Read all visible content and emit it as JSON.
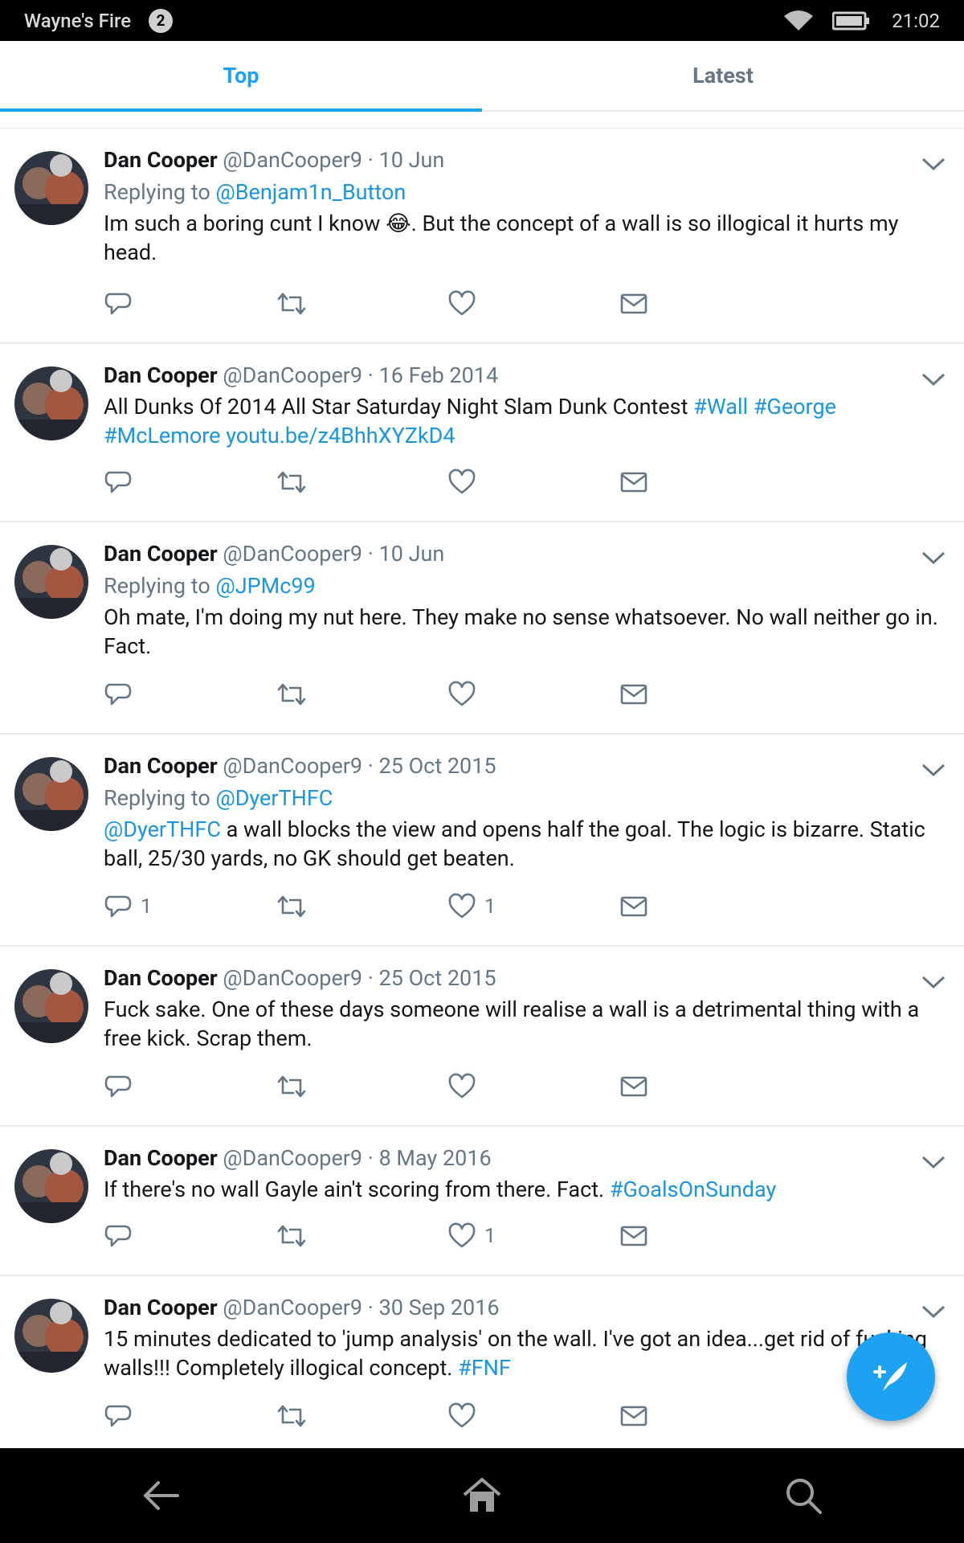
{
  "status_bar": {
    "app_name": "Wayne's Fire",
    "notification_count": "2",
    "time": "21:02",
    "icons": [
      "wifi-icon",
      "battery-icon"
    ]
  },
  "tabs": [
    {
      "label": "Top",
      "active": true
    },
    {
      "label": "Latest",
      "active": false
    }
  ],
  "tweets": [
    {
      "name": "Dan Cooper",
      "handle": "@DanCooper9",
      "date": "10 Jun",
      "replying_prefix": "Replying to",
      "replying_to": "@Benjam1n_Button",
      "text_a": "Im such a boring cunt I know ",
      "emoji": "😂",
      "text_b": ". But the concept of a wall is so illogical it hurts my head.",
      "replies": "",
      "likes": ""
    },
    {
      "name": "Dan Cooper",
      "handle": "@DanCooper9",
      "date": "16 Feb 2014",
      "text_a": "All Dunks Of 2014  All Star Saturday Night Slam Dunk Contest ",
      "tag1": "#Wall",
      "tag2": "#George",
      "tag3": "#McLemore",
      "url": "youtu.be/z4BhhXYZkD4",
      "replies": "",
      "likes": ""
    },
    {
      "name": "Dan Cooper",
      "handle": "@DanCooper9",
      "date": "10 Jun",
      "replying_prefix": "Replying to",
      "replying_to": "@JPMc99",
      "text": "Oh mate, I'm doing my nut here. They make no sense whatsoever. No wall neither go in. Fact.",
      "replies": "",
      "likes": ""
    },
    {
      "name": "Dan Cooper",
      "handle": "@DanCooper9",
      "date": "25 Oct 2015",
      "replying_prefix": "Replying to",
      "replying_to": "@DyerTHFC",
      "mention": "@DyerTHFC",
      "text": " a wall blocks the view and opens half the goal. The logic is bizarre. Static ball, 25/30 yards, no GK should get beaten.",
      "replies": "1",
      "likes": "1"
    },
    {
      "name": "Dan Cooper",
      "handle": "@DanCooper9",
      "date": "25 Oct 2015",
      "text": "Fuck sake. One of these days someone will realise a wall is a detrimental thing with a free kick. Scrap them.",
      "replies": "",
      "likes": ""
    },
    {
      "name": "Dan Cooper",
      "handle": "@DanCooper9",
      "date": "8 May 2016",
      "text": "If there's no wall Gayle ain't scoring from there. Fact. ",
      "tag": "#GoalsOnSunday",
      "replies": "",
      "likes": "1"
    },
    {
      "name": "Dan Cooper",
      "handle": "@DanCooper9",
      "date": "30 Sep 2016",
      "text": "15 minutes dedicated to 'jump analysis' on the wall. I've got an idea...get rid of fucking walls!!! Completely illogical concept. ",
      "tag": "#FNF",
      "replies": "",
      "likes": ""
    }
  ],
  "separator": "·",
  "fab": {
    "icon": "compose-tweet-icon"
  },
  "nav_bar": {
    "icons": [
      "back-icon",
      "home-icon",
      "search-icon"
    ]
  },
  "colors": {
    "accent": "#1da1f2",
    "link": "#1b95e0",
    "muted": "#657786"
  }
}
